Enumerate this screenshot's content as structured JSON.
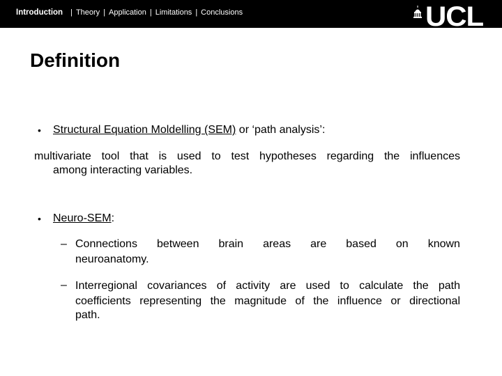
{
  "nav": {
    "items": [
      "Introduction",
      "Theory",
      "Application",
      "Limitations",
      "Conclusions"
    ],
    "active": "Introduction",
    "separator": "|"
  },
  "logo": {
    "text": "UCL",
    "icon": "portico-dome-icon"
  },
  "title": "Definition",
  "bullets": [
    {
      "marker": "•",
      "underlined": "Structural Equation Moldelling (SEM)",
      "rest": " or ‘path analysis’:"
    },
    {
      "marker": "•",
      "underlined": "Neuro-SEM",
      "rest": ":"
    }
  ],
  "definition_line1": "multivariate tool that is used to test hypotheses regarding the influences",
  "definition_line2": "among interacting variables.",
  "subpoints": [
    {
      "marker": "–",
      "line1_words": [
        "Connections",
        "between",
        "brain",
        "areas",
        "are",
        "based",
        "on",
        "known"
      ],
      "line2": "neuroanatomy."
    },
    {
      "marker": "–",
      "line1": "Interregional covariances of activity are used to calculate the path",
      "line2": "coefficients representing the magnitude of the influence or directional",
      "line3": "path."
    }
  ]
}
